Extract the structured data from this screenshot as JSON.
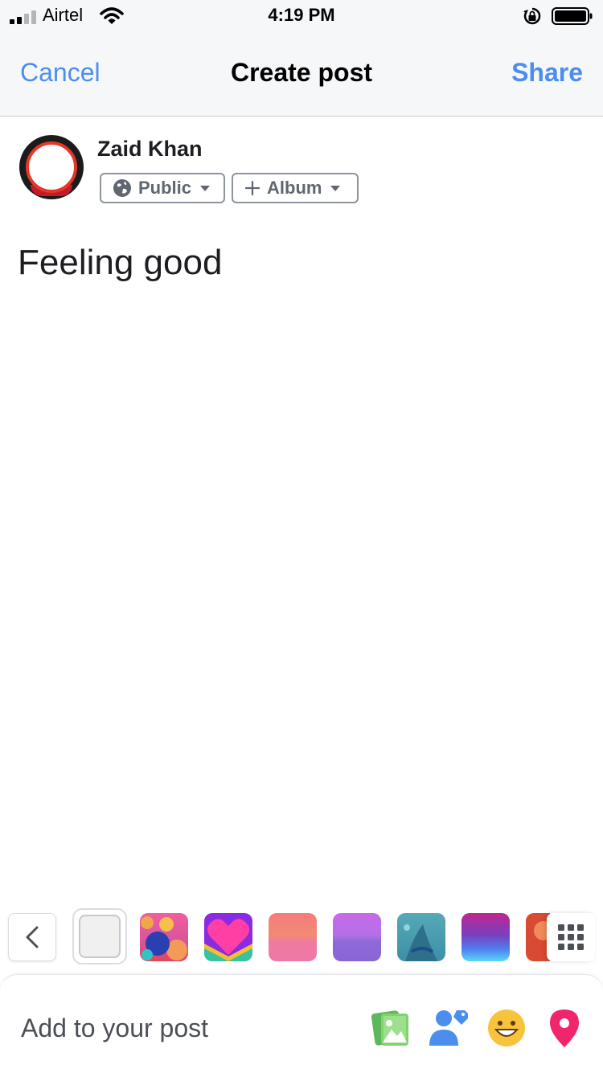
{
  "status_bar": {
    "carrier": "Airtel",
    "time": "4:19 PM",
    "signal_bars": 2
  },
  "nav": {
    "cancel_label": "Cancel",
    "title": "Create post",
    "share_label": "Share"
  },
  "author": {
    "name": "Zaid Khan",
    "audience_label": "Public",
    "album_label": "Album"
  },
  "post": {
    "text": "Feeling good"
  },
  "background_picker": {
    "swatches": [
      {
        "name": "plain",
        "selected": true
      },
      {
        "name": "planets-illustration"
      },
      {
        "name": "heart"
      },
      {
        "name": "coral-gradient"
      },
      {
        "name": "violet-gradient"
      },
      {
        "name": "teal-illustration"
      },
      {
        "name": "magenta-blue-gradient"
      },
      {
        "name": "orange-sphere"
      }
    ]
  },
  "add_to_post": {
    "label": "Add to your post",
    "icons": [
      "photo-icon",
      "tag-people-icon",
      "feeling-icon",
      "location-icon"
    ]
  },
  "colors": {
    "accent": "#4b8ef0",
    "nav_bg": "#f6f7f9"
  }
}
